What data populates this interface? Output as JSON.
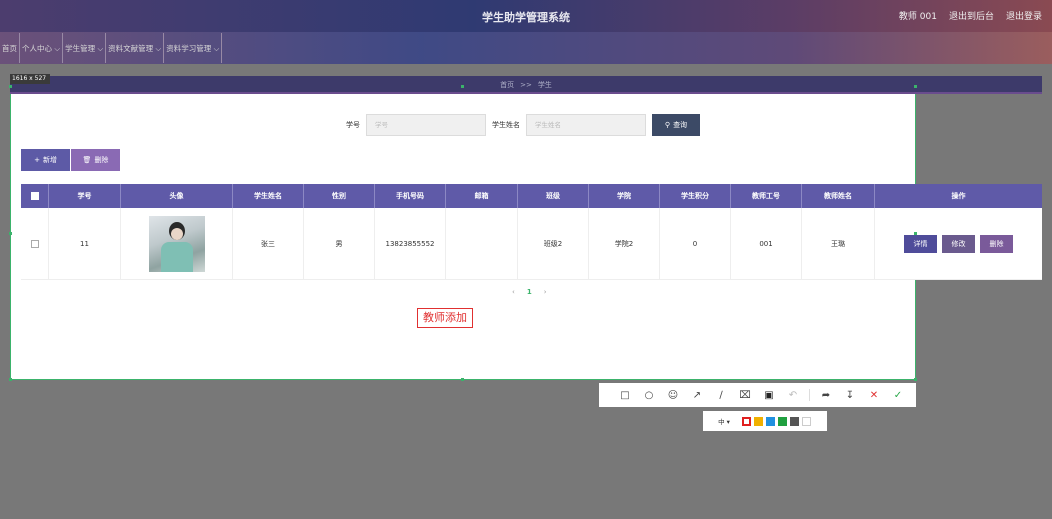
{
  "header": {
    "title": "学生助学管理系统",
    "user_label": "教师 001",
    "backend_link": "退出到后台",
    "logout_link": "退出登录"
  },
  "nav": {
    "items": [
      "首页",
      "个人中心 ⌵",
      "学生管理 ⌵",
      "资料文献管理 ⌵",
      "资料学习管理 ⌵"
    ]
  },
  "capture": {
    "size_label": "1616 x 527"
  },
  "breadcrumb": {
    "home": "首页",
    "sep": ">>",
    "current": "学生"
  },
  "search": {
    "id_label": "学号",
    "id_placeholder": "学号",
    "name_label": "学生姓名",
    "name_placeholder": "学生姓名",
    "query_label": "查询",
    "query_icon": "search-icon"
  },
  "actions": {
    "add_label": "新增",
    "delete_label": "删除"
  },
  "table": {
    "columns": [
      "学号",
      "头像",
      "学生姓名",
      "性别",
      "手机号码",
      "邮箱",
      "班级",
      "学院",
      "学生积分",
      "教师工号",
      "教师姓名",
      "操作"
    ],
    "rows": [
      {
        "id": "11",
        "name": "张三",
        "gender": "男",
        "phone": "13823855552",
        "email": "",
        "class": "班级2",
        "college": "学院2",
        "points": "0",
        "teacher_id": "001",
        "teacher_name": "王璐",
        "ops": {
          "detail": "详情",
          "edit": "修改",
          "delete": "删除"
        }
      }
    ]
  },
  "pager": {
    "prev": "‹",
    "current": "1",
    "next": "›"
  },
  "annotation": {
    "text": "教师添加"
  },
  "colors": {
    "accent": "#5f5aa8",
    "query_bg": "#3c4a66",
    "selection_border": "#3bb36b",
    "annotation_red": "#e03030",
    "swatches": [
      "#e02020",
      "#f0b000",
      "#2090e0",
      "#20a040",
      "#555555",
      "#ffffff"
    ]
  },
  "toolbar": {
    "size_label": "中 ▾",
    "tools": [
      "rect-icon",
      "ellipse-icon",
      "emoji-icon",
      "arrow-icon",
      "line-icon",
      "mosaic-icon",
      "text-icon",
      "undo-icon",
      "share-icon",
      "download-icon",
      "cancel-icon",
      "confirm-icon"
    ]
  }
}
